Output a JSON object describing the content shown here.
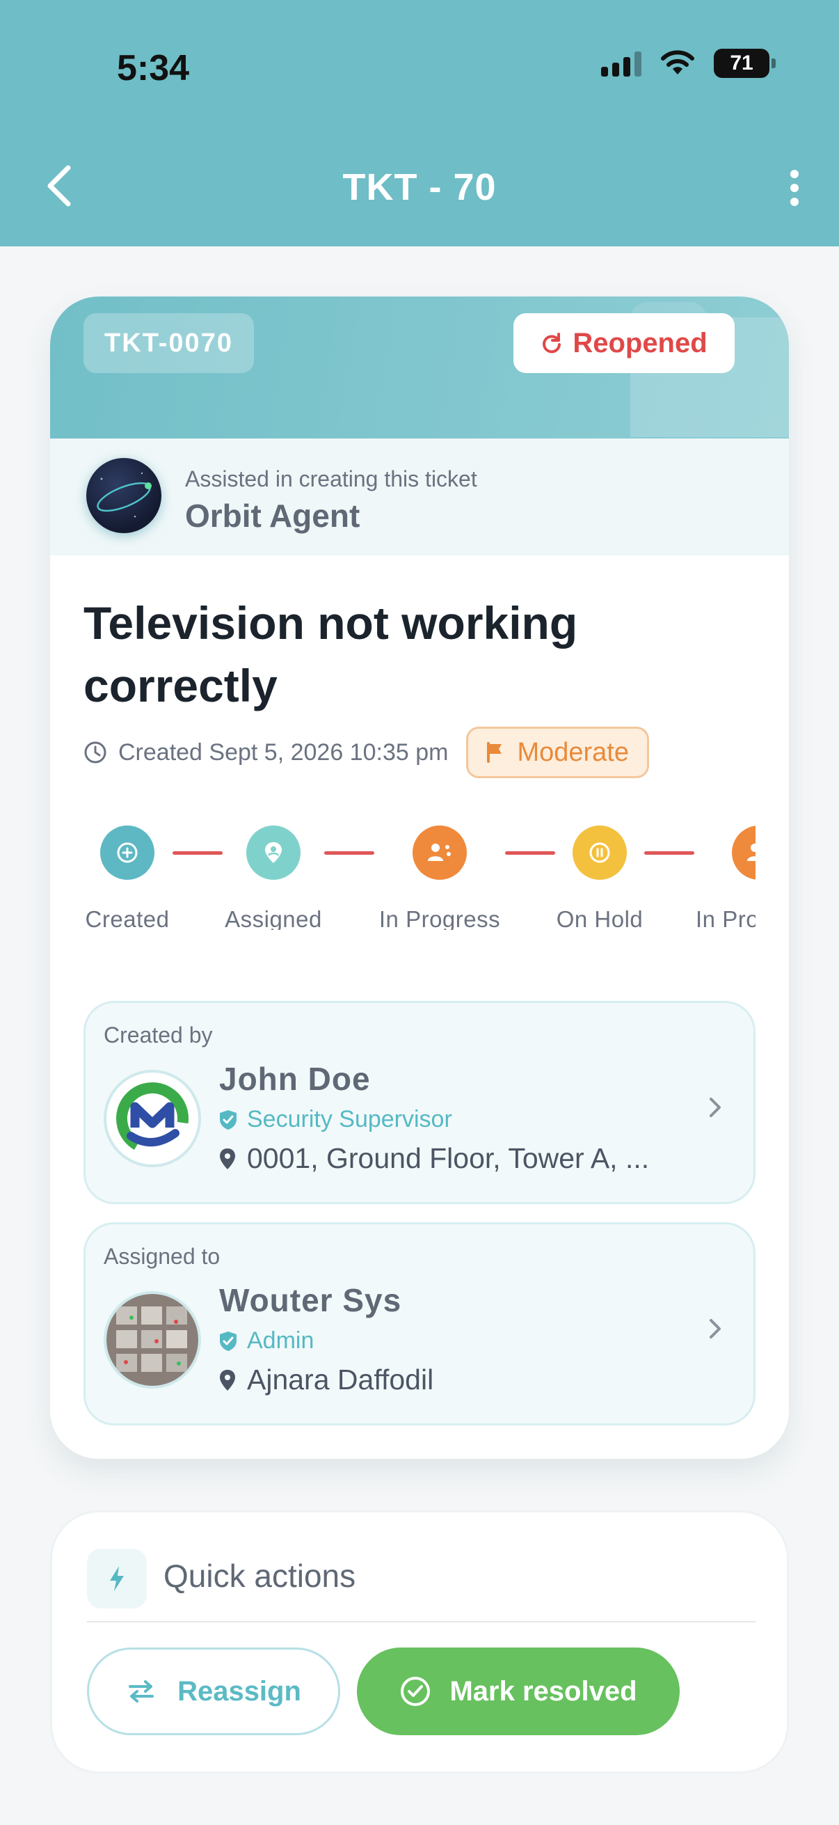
{
  "status_bar": {
    "time": "5:34",
    "battery": "71"
  },
  "header": {
    "title": "TKT - 70"
  },
  "ticket": {
    "id": "TKT-0070",
    "status": "Reopened",
    "assist_caption": "Assisted in creating this ticket",
    "assist_agent": "Orbit Agent",
    "title": "Television not working correctly",
    "created": "Created Sept 5, 2026 10:35 pm",
    "priority": "Moderate"
  },
  "timeline": {
    "steps": [
      {
        "label": "Created",
        "color": "#5db8c3"
      },
      {
        "label": "Assigned",
        "color": "#7fd2cb"
      },
      {
        "label": "In Progress",
        "color": "#ef8a3c"
      },
      {
        "label": "On Hold",
        "color": "#f4c13f"
      },
      {
        "label": "In Progress",
        "color": "#ef8a3c"
      }
    ],
    "connector_color": "#e05656"
  },
  "created_by": {
    "caption": "Created by",
    "name": "John Doe",
    "role": "Security Supervisor",
    "location": "0001, Ground Floor, Tower A, ..."
  },
  "assigned_to": {
    "caption": "Assigned to",
    "name": "Wouter Sys",
    "role": "Admin",
    "location": "Ajnara Daffodil"
  },
  "quick_actions": {
    "title": "Quick actions",
    "reassign": "Reassign",
    "resolve": "Mark resolved"
  },
  "colors": {
    "header": "#6fbdc6",
    "accent": "#5bbac5",
    "danger": "#e04848",
    "success": "#67c15e",
    "warning": "#e98a3a"
  }
}
